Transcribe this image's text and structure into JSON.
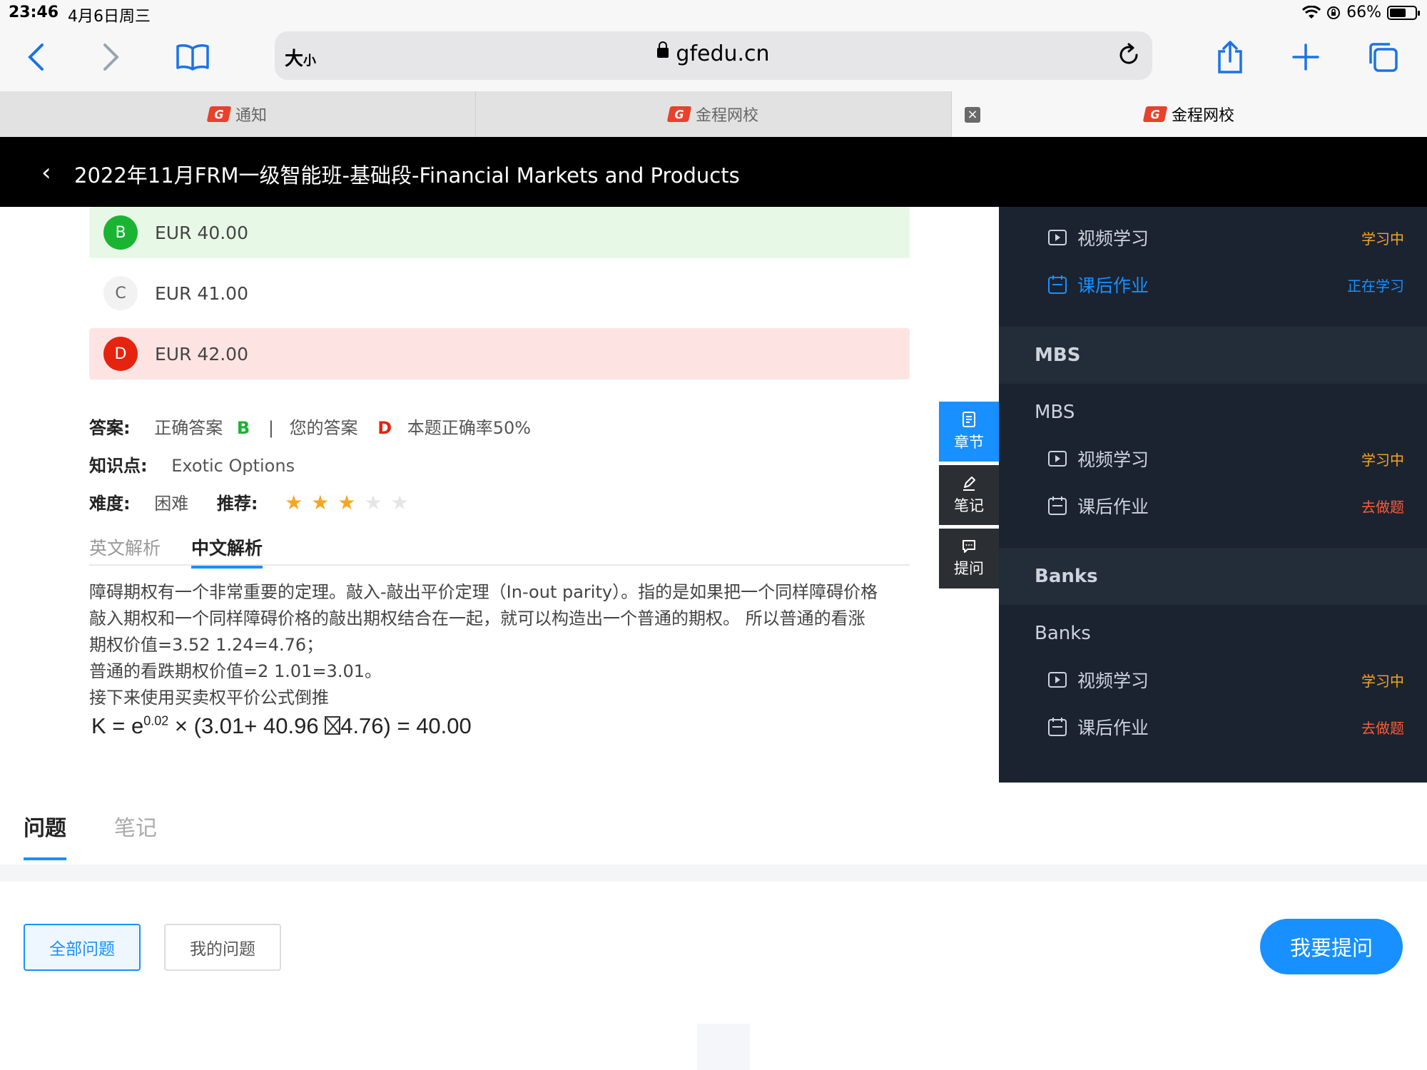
{
  "status": {
    "time": "23:46",
    "date": "4月6日周三",
    "battery": "66%",
    "battery_level": 0.66
  },
  "browser": {
    "size_label": "大",
    "size_label_small": "小",
    "url": "gfedu.cn"
  },
  "tabs": [
    {
      "label": "通知"
    },
    {
      "label": "金程网校"
    },
    {
      "label": "金程网校"
    }
  ],
  "tab_close": "×",
  "tab_logo": "G",
  "header": {
    "back": "‹",
    "title": "2022年11月FRM一级智能班-基础段-Financial Markets and Products"
  },
  "options": [
    {
      "letter": "B",
      "text": "EUR 40.00"
    },
    {
      "letter": "C",
      "text": "EUR 41.00"
    },
    {
      "letter": "D",
      "text": "EUR 42.00"
    }
  ],
  "answer": {
    "label": "答案:",
    "correct_label": "正确答案",
    "correct": "B",
    "sep": "|",
    "yours_label": "您的答案",
    "yours": "D",
    "rate": "本题正确率50%"
  },
  "knowledge": {
    "label": "知识点:",
    "value": "Exotic Options"
  },
  "difficulty": {
    "label": "难度:",
    "value": "困难",
    "recommend_label": "推荐:",
    "stars": 3,
    "max_stars": 5
  },
  "star_glyph": "★",
  "analysis_tabs": {
    "en": "英文解析",
    "cn": "中文解析"
  },
  "analysis": {
    "line1": "障碍期权有一个非常重要的定理。敲入-敲出平价定理（In-out parity）。指的是如果把一个同样障碍价格",
    "line2": "敲入期权和一个同样障碍价格的敲出期权结合在一起，就可以构造出一个普通的期权。 所以普通的看涨",
    "line3": "期权价值=3.52 1.24=4.76；",
    "line4": "普通的看跌期权价值=2 1.01=3.01。",
    "line5": "接下来使用买卖权平价公式倒推"
  },
  "formula": {
    "lhs": "K = e",
    "exp": "0.02",
    "times": " × (3.01+ 40.96 ",
    "rhs": "4.76) = 40.00"
  },
  "side_tools": {
    "chapter": "章节",
    "note": "笔记",
    "ask": "提问"
  },
  "panel": {
    "items": [
      {
        "label": "视频学习",
        "status": "学习中"
      },
      {
        "label": "课后作业",
        "status": "正在学习"
      },
      {
        "section": "MBS"
      },
      {
        "chapter": "MBS"
      },
      {
        "label": "视频学习",
        "status": "学习中"
      },
      {
        "label": "课后作业",
        "status": "去做题"
      },
      {
        "section": "Banks"
      },
      {
        "chapter": "Banks"
      },
      {
        "label": "视频学习",
        "status": "学习中"
      },
      {
        "label": "课后作业",
        "status": "去做题"
      }
    ]
  },
  "bottom": {
    "tab_questions": "问题",
    "tab_notes": "笔记",
    "all_questions": "全部问题",
    "my_questions": "我的问题",
    "ask_button": "我要提问"
  },
  "colors": {
    "accent": "#1890ff",
    "correct": "#1ab432",
    "wrong": "#e6230f",
    "learning": "#f5a623",
    "panel_bg": "#1b2330"
  }
}
